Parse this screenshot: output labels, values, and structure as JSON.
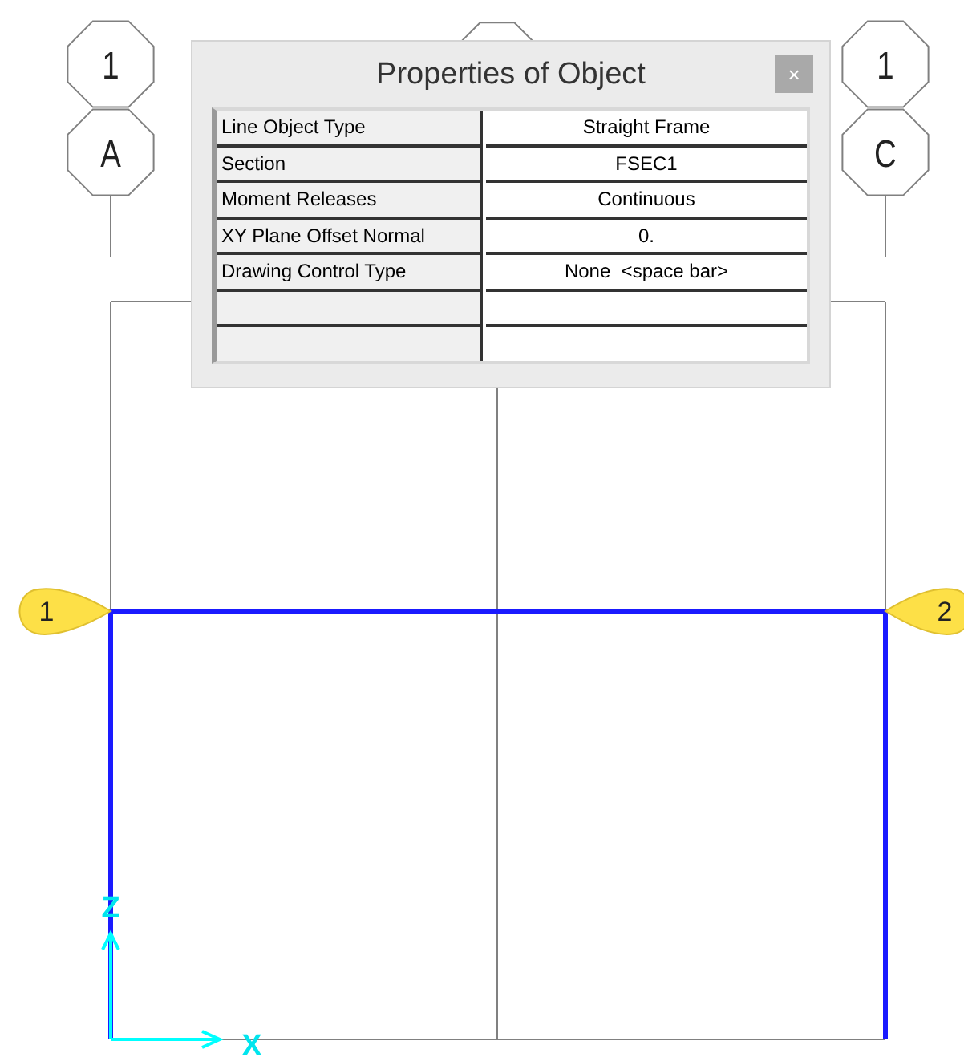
{
  "grid_columns": [
    {
      "bubbles": [
        "1",
        "A"
      ]
    },
    {
      "bubbles": [
        "1",
        "C"
      ]
    }
  ],
  "story_markers": [
    {
      "label": "1"
    },
    {
      "label": "2"
    }
  ],
  "axes": {
    "z": "Z",
    "x": "X"
  },
  "dialog": {
    "title": "Properties of Object",
    "close": "×",
    "rows": [
      {
        "name": "Line Object Type",
        "value": "Straight Frame"
      },
      {
        "name": "Section",
        "value": "FSEC1"
      },
      {
        "name": "Moment Releases",
        "value": "Continuous"
      },
      {
        "name": "XY Plane Offset Normal",
        "value": "0."
      },
      {
        "name": "Drawing Control Type",
        "value": "None  <space bar>"
      }
    ]
  }
}
